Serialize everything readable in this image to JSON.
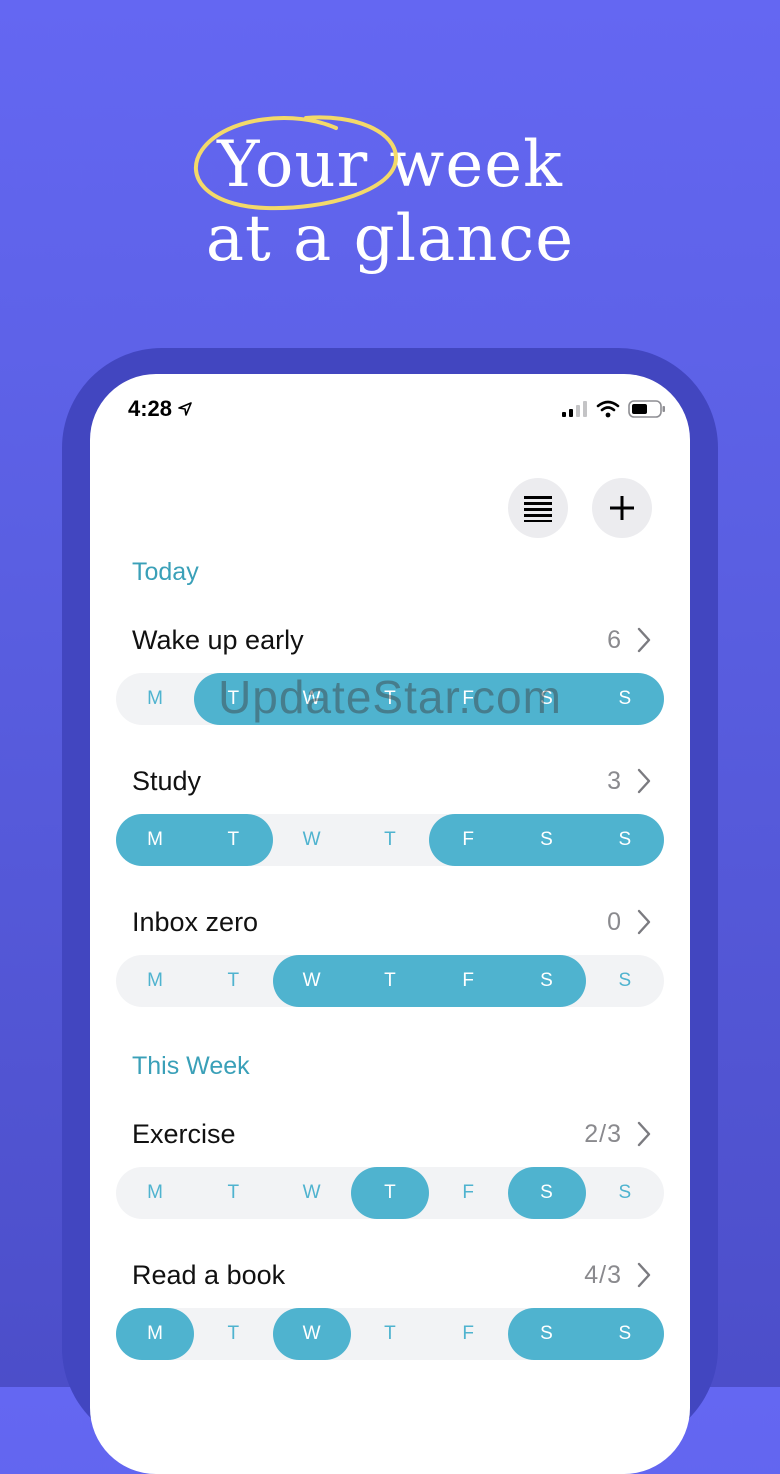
{
  "headline": {
    "line1": "Your week",
    "line2": "at a glance"
  },
  "status": {
    "time": "4:28"
  },
  "toolbar": {
    "list_icon": "list-icon",
    "add_icon": "plus-icon"
  },
  "sections": {
    "today": "Today",
    "this_week": "This Week"
  },
  "days": [
    "M",
    "T",
    "W",
    "T",
    "F",
    "S",
    "S"
  ],
  "habits": [
    {
      "name": "Wake up early",
      "count": "6",
      "done": [
        false,
        true,
        true,
        true,
        true,
        true,
        true
      ]
    },
    {
      "name": "Study",
      "count": "3",
      "done": [
        true,
        true,
        false,
        false,
        true,
        true,
        true
      ]
    },
    {
      "name": "Inbox zero",
      "count": "0",
      "done": [
        false,
        false,
        true,
        true,
        true,
        true,
        false
      ]
    },
    {
      "name": "Exercise",
      "count": "2/3",
      "done": [
        false,
        false,
        false,
        true,
        false,
        true,
        false
      ]
    },
    {
      "name": "Read a book",
      "count": "4/3",
      "done": [
        true,
        false,
        true,
        false,
        false,
        true,
        true
      ]
    }
  ],
  "watermark": "UpdateStar.com",
  "colors": {
    "accent": "#4fb3cf",
    "section": "#3aa0b8",
    "background": "#5a5fe2",
    "frame": "#4246c0",
    "highlight": "#f3d96a"
  }
}
